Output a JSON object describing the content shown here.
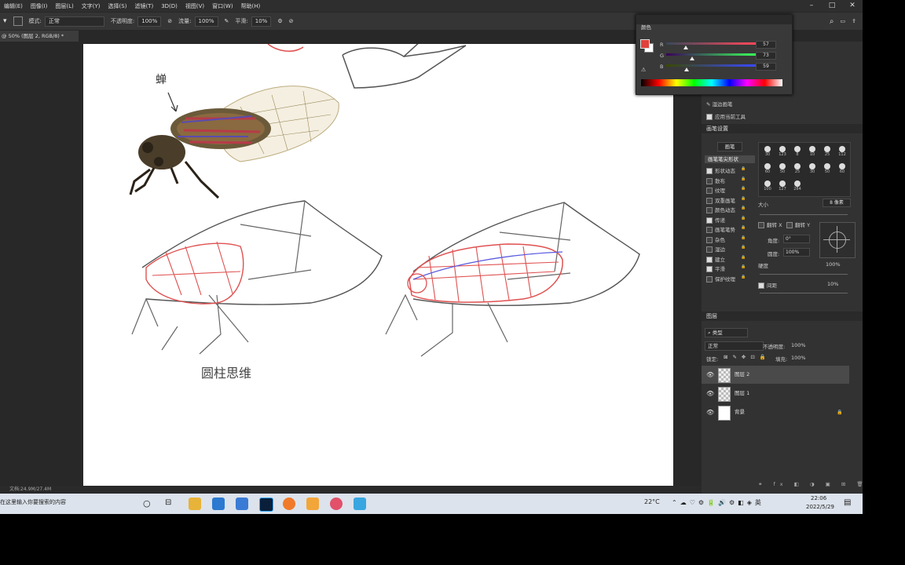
{
  "menu": [
    "编辑(E)",
    "图像(I)",
    "图层(L)",
    "文字(Y)",
    "选择(S)",
    "滤镜(T)",
    "3D(D)",
    "视图(V)",
    "窗口(W)",
    "帮助(H)"
  ],
  "options": {
    "mode_label": "模式:",
    "mode_value": "正常",
    "opacity_label": "不透明度:",
    "opacity_value": "100%",
    "flow_label": "流量:",
    "flow_value": "100%",
    "smooth_label": "平滑:",
    "smooth_value": "10%"
  },
  "doc_tab": "@ 50% (图层 2, RGB/8) *",
  "canvas": {
    "handwriting_top": "蝉",
    "handwriting_bottom": "圆柱思维"
  },
  "status_text": "文档:24.9M/27.4M",
  "color_panel": {
    "title": "颜色",
    "r_label": "R",
    "r": "57",
    "g_label": "G",
    "g": "73",
    "b_label": "B",
    "b": "59",
    "r_fill": 0.22,
    "g_fill": 0.29,
    "b_fill": 0.23,
    "colors": {
      "foreground": "#e0413a",
      "background": "#ffffff"
    }
  },
  "brush_section": {
    "preset_label": "湿边画笔",
    "apply_label": "应用当前工具"
  },
  "brush_settings": {
    "title": "画笔设置",
    "presets_btn": "画笔",
    "tip_shape": "画笔笔尖形状",
    "options": [
      {
        "label": "形状动态",
        "checked": true
      },
      {
        "label": "散布",
        "checked": false
      },
      {
        "label": "纹理",
        "checked": false
      },
      {
        "label": "双重画笔",
        "checked": false
      },
      {
        "label": "颜色动态",
        "checked": false
      },
      {
        "label": "传递",
        "checked": true
      },
      {
        "label": "画笔笔势",
        "checked": false
      },
      {
        "label": "杂色",
        "checked": false
      },
      {
        "label": "湿边",
        "checked": false
      },
      {
        "label": "建立",
        "checked": true
      },
      {
        "label": "平滑",
        "checked": true
      },
      {
        "label": "保护纹理",
        "checked": false
      }
    ],
    "tip_sizes": [
      "30",
      "123",
      "8",
      "10",
      "25",
      "112",
      "60",
      "50",
      "25",
      "30",
      "50",
      "60",
      "100",
      "127",
      "284"
    ],
    "size_label": "大小",
    "size_value": "8 像素",
    "flip_x": "翻转 X",
    "flip_y": "翻转 Y",
    "angle_label": "角度:",
    "angle_value": "0°",
    "roundness_label": "圆度:",
    "roundness_value": "100%",
    "hardness_label": "硬度",
    "hardness_value": "100%",
    "spacing_label": "间距",
    "spacing_value": "10%"
  },
  "layers_panel": {
    "title": "图层",
    "filter_label": "类型",
    "blend_mode": "正常",
    "opacity_label": "不透明度:",
    "opacity_value": "100%",
    "lock_label": "锁定:",
    "fill_label": "填充:",
    "fill_value": "100%",
    "layers": [
      {
        "name": "图层 2",
        "selected": true
      },
      {
        "name": "图层 1",
        "selected": false
      },
      {
        "name": "背景",
        "selected": false
      }
    ]
  },
  "taskbar": {
    "search_placeholder": "在这里输入你要搜索的内容",
    "temperature": "22°C",
    "time": "22:06",
    "date": "2022/5/29"
  }
}
